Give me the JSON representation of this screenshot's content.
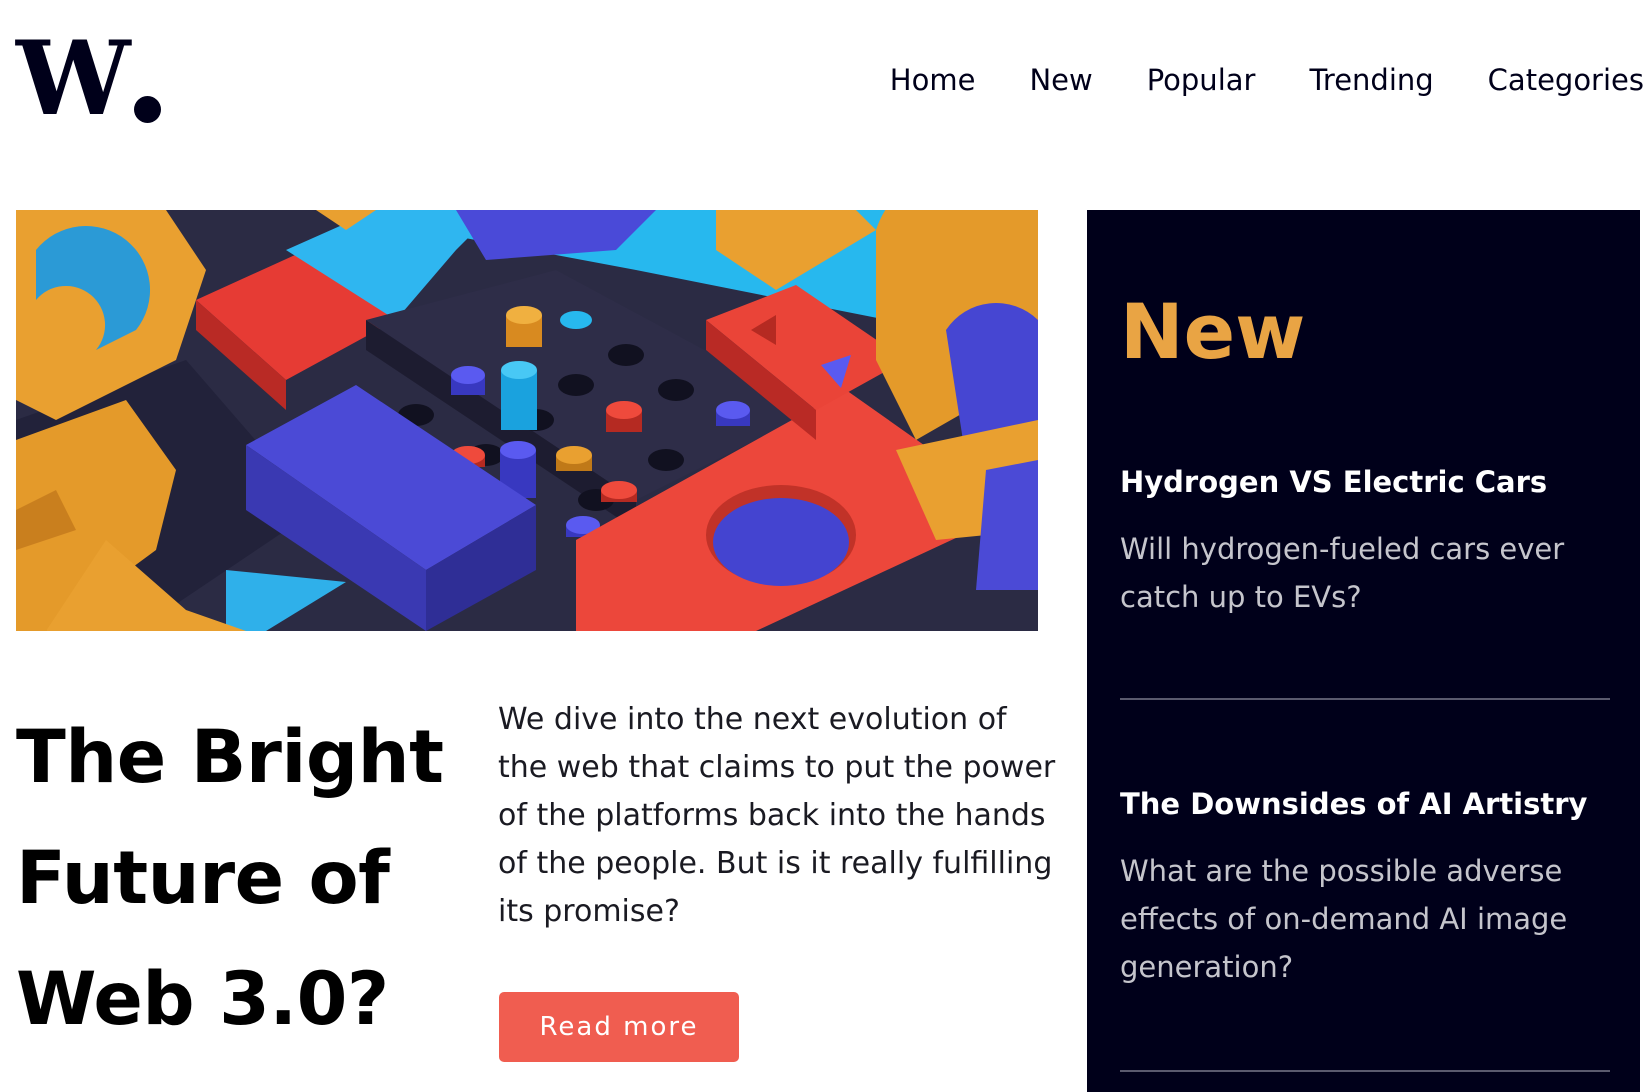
{
  "header": {
    "logo_text": "W",
    "nav": [
      "Home",
      "New",
      "Popular",
      "Trending",
      "Categories"
    ]
  },
  "hero": {
    "image_alt": "colorful 3D wooden blocks and pegs"
  },
  "article": {
    "title": "The Bright Future of Web 3.0?",
    "summary": "We dive into the next evolution of the web that claims to put the power of the platforms back into the hands of the people. But is it really fulfilling its promise?",
    "cta_label": "Read more"
  },
  "sidebar": {
    "title": "New",
    "items": [
      {
        "title": "Hydrogen VS Electric Cars",
        "description": "Will hydrogen-fueled cars ever catch up to EVs?"
      },
      {
        "title": "The Downsides of AI Artistry",
        "description": "What are the possible adverse effects of on-demand AI image generation?"
      }
    ]
  },
  "colors": {
    "accent": "#e9a444",
    "cta": "#f05d50",
    "dark": "#00001a"
  },
  "icons": [
    "logo-mark"
  ]
}
